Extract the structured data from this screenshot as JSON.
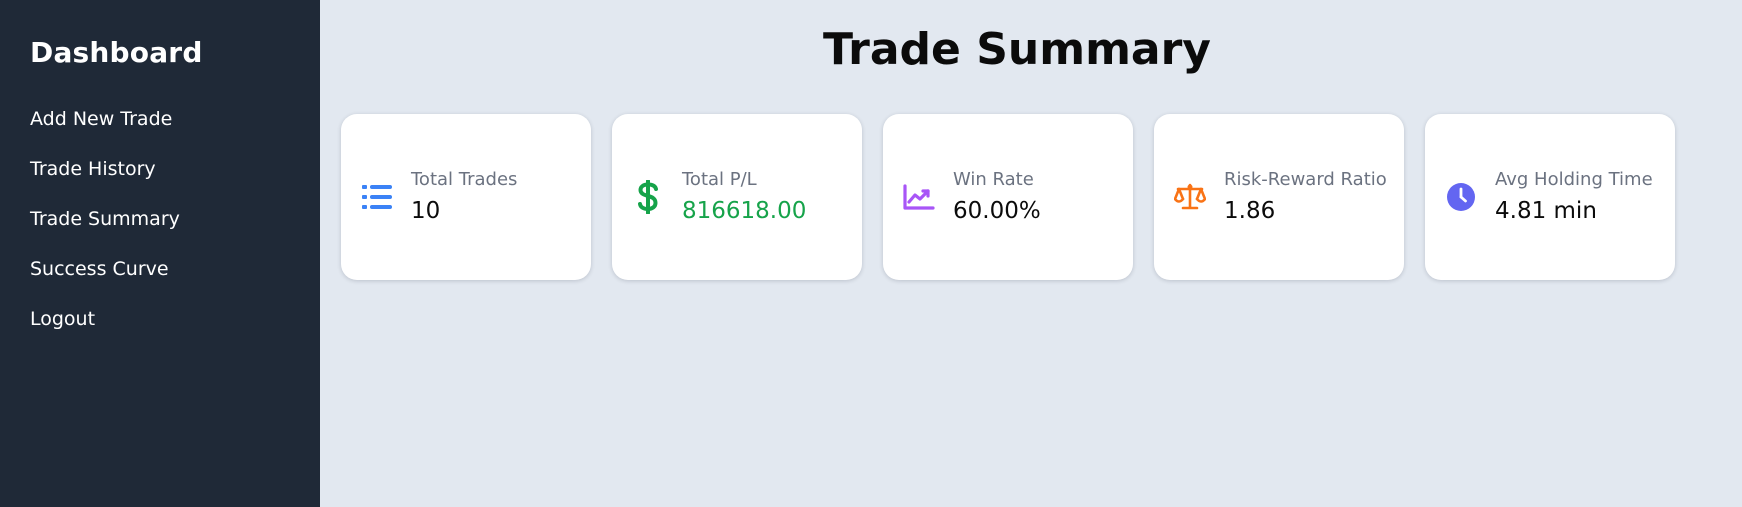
{
  "sidebar": {
    "brand": "Dashboard",
    "items": [
      {
        "label": "Add New Trade"
      },
      {
        "label": "Trade History"
      },
      {
        "label": "Trade Summary"
      },
      {
        "label": "Success Curve"
      },
      {
        "label": "Logout"
      }
    ]
  },
  "main": {
    "title": "Trade Summary",
    "cards": [
      {
        "label": "Total Trades",
        "value": "10",
        "icon": "list-icon",
        "icon_color": "#3b82f6",
        "value_color": "#0b0b0b"
      },
      {
        "label": "Total P/L",
        "value": "816618.00",
        "icon": "dollar-icon",
        "icon_color": "#16a34a",
        "value_color": "#16a34a"
      },
      {
        "label": "Win Rate",
        "value": "60.00%",
        "icon": "chart-line-icon",
        "icon_color": "#a855f7",
        "value_color": "#0b0b0b"
      },
      {
        "label": "Risk-Reward Ratio",
        "value": "1.86",
        "icon": "balance-scale-icon",
        "icon_color": "#f97316",
        "value_color": "#0b0b0b"
      },
      {
        "label": "Avg Holding Time",
        "value": "4.81 min",
        "icon": "clock-icon",
        "icon_color": "#6366f1",
        "value_color": "#0b0b0b"
      }
    ]
  },
  "colors": {
    "sidebar_bg": "#1f2937",
    "page_bg": "#e2e8f0",
    "card_bg": "#ffffff"
  }
}
